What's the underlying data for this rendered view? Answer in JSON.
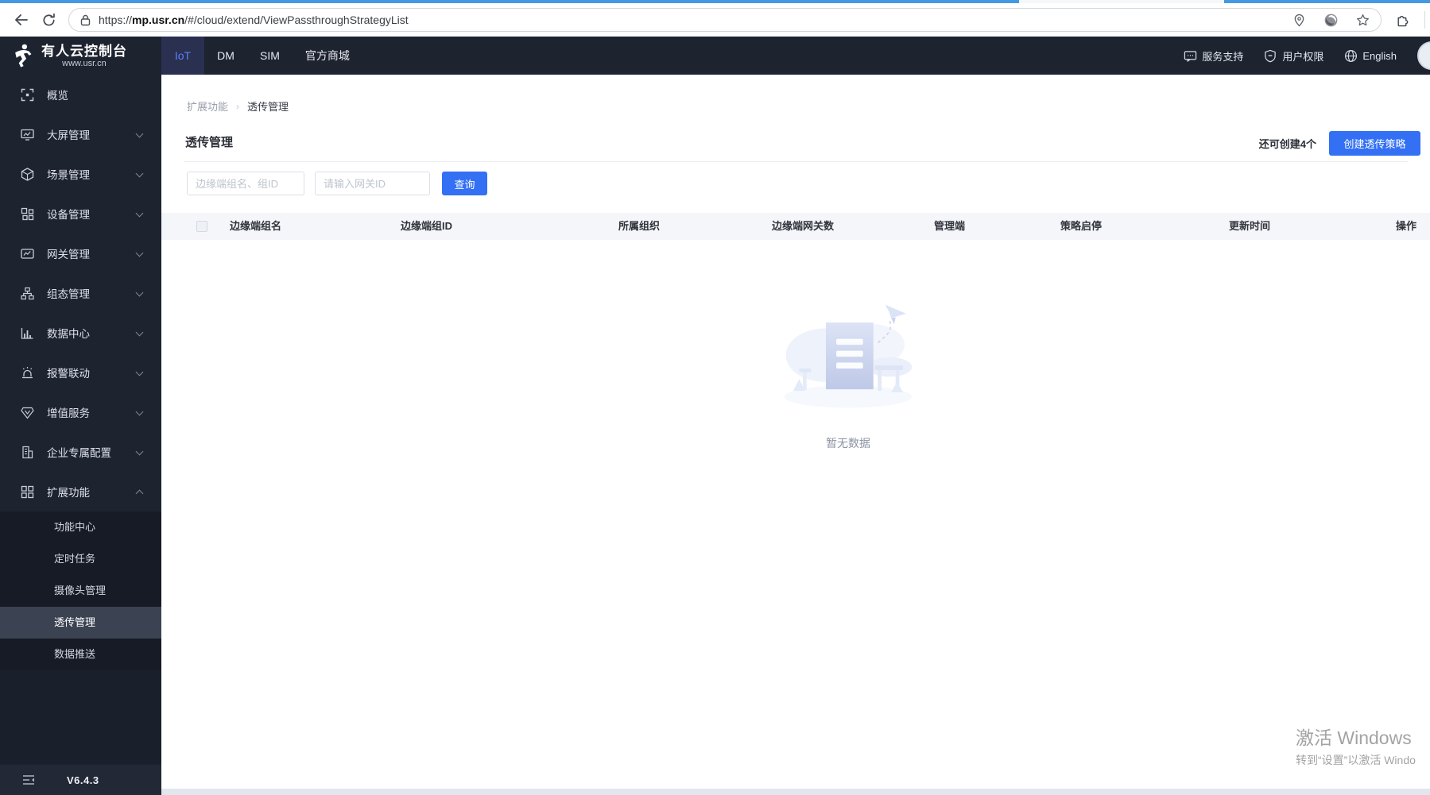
{
  "browser": {
    "url": {
      "scheme": "https://",
      "host": "mp.usr.cn",
      "path": "/#/cloud/extend/ViewPassthroughStrategyList"
    }
  },
  "header": {
    "logo": {
      "title": "有人云控制台",
      "subtitle": "www.usr.cn"
    },
    "tabs": [
      {
        "label": "IoT"
      },
      {
        "label": "DM"
      },
      {
        "label": "SIM"
      },
      {
        "label": "官方商城"
      }
    ],
    "active_tab": "IoT",
    "links": {
      "support": "服务支持",
      "permissions": "用户权限",
      "language": "English"
    }
  },
  "sidebar": {
    "items": [
      {
        "label": "概览"
      },
      {
        "label": "大屏管理"
      },
      {
        "label": "场景管理"
      },
      {
        "label": "设备管理"
      },
      {
        "label": "网关管理"
      },
      {
        "label": "组态管理"
      },
      {
        "label": "数据中心"
      },
      {
        "label": "报警联动"
      },
      {
        "label": "增值服务"
      },
      {
        "label": "企业专属配置"
      },
      {
        "label": "扩展功能"
      }
    ],
    "submenu": [
      {
        "label": "功能中心"
      },
      {
        "label": "定时任务"
      },
      {
        "label": "摄像头管理"
      },
      {
        "label": "透传管理"
      },
      {
        "label": "数据推送"
      }
    ],
    "active_item": "透传管理",
    "version": "V6.4.3"
  },
  "main": {
    "breadcrumb": {
      "parent": "扩展功能",
      "current": "透传管理"
    },
    "page_title": "透传管理",
    "quota_text": "还可创建4个",
    "create_button_label": "创建透传策略",
    "filters": {
      "group_placeholder": "边缘端组名、组ID",
      "gateway_placeholder": "请输入网关ID",
      "query_button_label": "查询"
    },
    "table": {
      "columns": [
        "边缘端组名",
        "边缘端组ID",
        "所属组织",
        "边缘端网关数",
        "管理端",
        "策略启停",
        "更新时间",
        "操作"
      ]
    },
    "empty_text": "暂无数据"
  },
  "watermark": {
    "line1": "激活 Windows",
    "line2": "转到“设置”以激活 Windo"
  },
  "colors": {
    "accent_blue": "#3370f4",
    "header_bg": "#1e2330",
    "active_tab_text": "#5b80fa",
    "progress_blue": "#4599e2"
  }
}
